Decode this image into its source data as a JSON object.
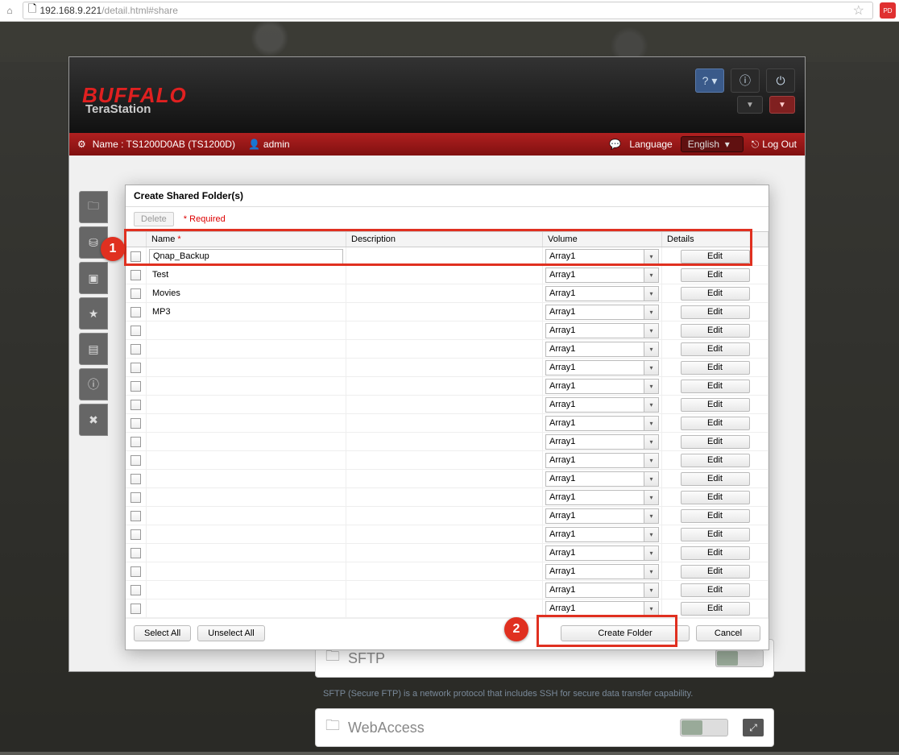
{
  "browser": {
    "url_host": "192.168.9.221",
    "url_path": "/detail.html#share"
  },
  "header": {
    "brand": "BUFFALO",
    "product": "TeraStation",
    "device_name": "Name : TS1200D0AB (TS1200D)",
    "user": "admin",
    "language_label": "Language",
    "language_value": "English",
    "logout": "Log Out"
  },
  "modal": {
    "title": "Create Shared Folder(s)",
    "delete_btn": "Delete",
    "required_note": "*   Required",
    "columns": {
      "name": "Name",
      "description": "Description",
      "volume": "Volume",
      "details": "Details"
    },
    "edit_label": "Edit",
    "default_volume": "Array1",
    "rows": [
      {
        "name": "Qnap_Backup",
        "editing": true
      },
      {
        "name": "Test"
      },
      {
        "name": "Movies"
      },
      {
        "name": "MP3"
      },
      {
        "name": ""
      },
      {
        "name": ""
      },
      {
        "name": ""
      },
      {
        "name": ""
      },
      {
        "name": ""
      },
      {
        "name": ""
      },
      {
        "name": ""
      },
      {
        "name": ""
      },
      {
        "name": ""
      },
      {
        "name": ""
      },
      {
        "name": ""
      },
      {
        "name": ""
      },
      {
        "name": ""
      },
      {
        "name": ""
      },
      {
        "name": ""
      },
      {
        "name": ""
      }
    ],
    "footer": {
      "select_all": "Select All",
      "unselect_all": "Unselect All",
      "create": "Create Folder",
      "cancel": "Cancel"
    }
  },
  "sections": {
    "sftp_title": "SFTP",
    "sftp_desc": "SFTP (Secure FTP) is a network protocol that includes SSH for secure data transfer capability.",
    "webaccess_title": "WebAccess"
  },
  "annotations": {
    "marker1": "1",
    "marker2": "2"
  }
}
